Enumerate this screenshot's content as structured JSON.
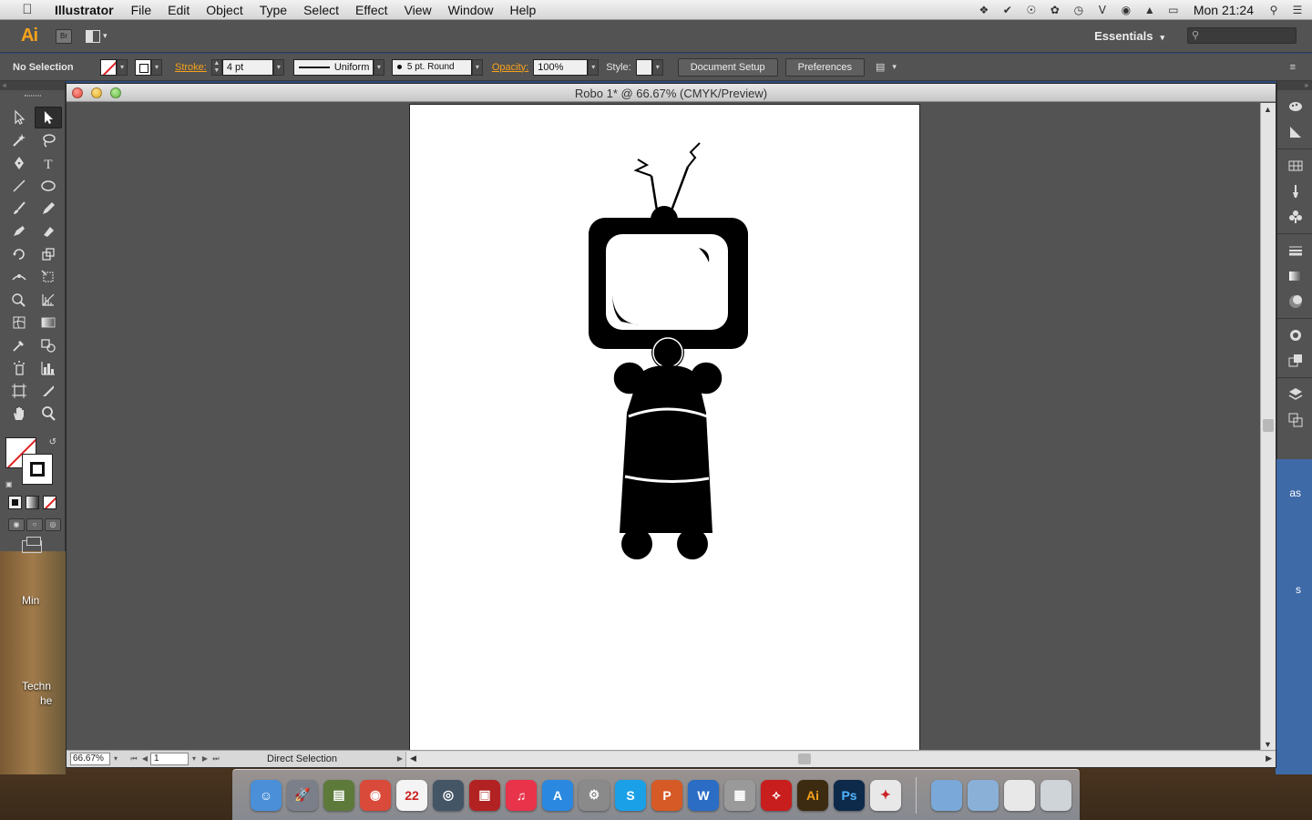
{
  "menubar": {
    "app_name": "Illustrator",
    "items": [
      "File",
      "Edit",
      "Object",
      "Type",
      "Select",
      "Effect",
      "View",
      "Window",
      "Help"
    ],
    "clock": "Mon 21:24"
  },
  "appbar": {
    "logo": "Ai",
    "bridge": "Br",
    "workspace": "Essentials"
  },
  "control": {
    "selection": "No Selection",
    "stroke_label": "Stroke:",
    "stroke_weight": "4 pt",
    "profile": "Uniform",
    "brush": "5 pt. Round",
    "opacity_label": "Opacity:",
    "opacity": "100%",
    "style_label": "Style:",
    "doc_setup": "Document Setup",
    "preferences": "Preferences"
  },
  "document": {
    "title": "Robo 1* @ 66.67% (CMYK/Preview)",
    "zoom": "66.67%",
    "artboard": "1",
    "status": "Direct Selection"
  },
  "desktop": {
    "left_labels": [
      "Min",
      "Techn",
      "he"
    ],
    "right_labels": [
      "as",
      "s"
    ]
  },
  "colors": {
    "accent": "#f7a21b",
    "panel": "#535353",
    "none_red": "#e02020"
  },
  "dock": {
    "apps": [
      {
        "name": "finder",
        "label": "☺",
        "color": "#4a8fd8"
      },
      {
        "name": "launchpad",
        "label": "🚀",
        "color": "#7a7f8a"
      },
      {
        "name": "preview",
        "label": "▤",
        "color": "#5d7a3a"
      },
      {
        "name": "chrome",
        "label": "◉",
        "color": "#d94a3a"
      },
      {
        "name": "calendar",
        "label": "22",
        "color": "#f4f4f4"
      },
      {
        "name": "screenshot",
        "label": "◎",
        "color": "#445566"
      },
      {
        "name": "photobooth",
        "label": "▣",
        "color": "#b22222"
      },
      {
        "name": "itunes",
        "label": "♫",
        "color": "#e8334a"
      },
      {
        "name": "appstore",
        "label": "A",
        "color": "#2a88e0"
      },
      {
        "name": "sysprefs",
        "label": "⚙",
        "color": "#8a8a8a"
      },
      {
        "name": "skype",
        "label": "S",
        "color": "#1aa0e6"
      },
      {
        "name": "powerpoint",
        "label": "P",
        "color": "#d65a26"
      },
      {
        "name": "word",
        "label": "W",
        "color": "#2b6dc4"
      },
      {
        "name": "calculator",
        "label": "▦",
        "color": "#9a9a9a"
      },
      {
        "name": "acrobat",
        "label": "⟡",
        "color": "#c81e1e"
      },
      {
        "name": "illustrator",
        "label": "Ai",
        "color": "#3c2b10"
      },
      {
        "name": "photoshop",
        "label": "Ps",
        "color": "#0e2a4a"
      },
      {
        "name": "misc-app",
        "label": "✦",
        "color": "#e8e8e8"
      }
    ],
    "stacks": [
      {
        "name": "applications-folder",
        "color": "#7aa8d8"
      },
      {
        "name": "downloads-folder",
        "color": "#8ab0d8"
      },
      {
        "name": "documents-stack",
        "color": "#e8e8e8"
      },
      {
        "name": "trash",
        "color": "#cfd4d8"
      }
    ]
  }
}
